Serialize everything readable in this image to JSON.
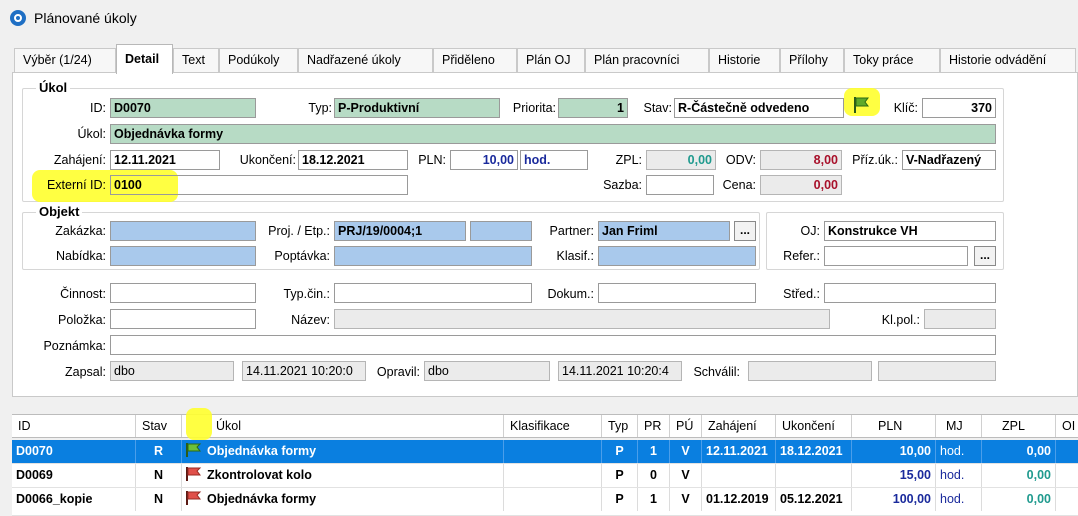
{
  "window": {
    "title": "Plánované úkoly"
  },
  "tabs": [
    {
      "label": "Výběr (1/24)"
    },
    {
      "label": "Detail"
    },
    {
      "label": "Text"
    },
    {
      "label": "Podúkoly"
    },
    {
      "label": "Nadřazené úkoly"
    },
    {
      "label": "Přiděleno"
    },
    {
      "label": "Plán OJ"
    },
    {
      "label": "Plán pracovníci"
    },
    {
      "label": "Historie"
    },
    {
      "label": "Přílohy"
    },
    {
      "label": "Toky práce"
    },
    {
      "label": "Historie odvádění"
    }
  ],
  "ukol": {
    "group_title": "Úkol",
    "id_label": "ID:",
    "id_value": "D0070",
    "typ_label": "Typ:",
    "typ_value": "P-Produktivní",
    "priorita_label": "Priorita:",
    "priorita_value": "1",
    "stav_label": "Stav:",
    "stav_value": "R-Částečně odvedeno",
    "klic_label": "Klíč:",
    "klic_value": "370",
    "ukol_label": "Úkol:",
    "ukol_value": "Objednávka formy",
    "zahajeni_label": "Zahájení:",
    "zahajeni_value": "12.11.2021",
    "ukonceni_label": "Ukončení:",
    "ukonceni_value": "18.12.2021",
    "pln_label": "PLN:",
    "pln_value": "10,00",
    "pln_unit": "hod.",
    "zpl_label": "ZPL:",
    "zpl_value": "0,00",
    "odv_label": "ODV:",
    "odv_value": "8,00",
    "priz_label": "Příz.úk.:",
    "priz_value": "V-Nadřazený",
    "externi_label": "Externí ID:",
    "externi_value": "0100",
    "sazba_label": "Sazba:",
    "sazba_value": "",
    "cena_label": "Cena:",
    "cena_value": "0,00"
  },
  "objekt": {
    "group_title": "Objekt",
    "zakazka_label": "Zakázka:",
    "zakazka_value": "",
    "proj_label": "Proj. / Etp.:",
    "proj_value": "PRJ/19/0004;1",
    "etp_value": "",
    "partner_label": "Partner:",
    "partner_value": "Jan Friml",
    "oj_label": "OJ:",
    "oj_value": "Konstrukce VH",
    "nabidka_label": "Nabídka:",
    "nabidka_value": "",
    "poptavka_label": "Poptávka:",
    "poptavka_value": "",
    "klasif_label": "Klasif.:",
    "klasif_value": "",
    "refer_label": "Refer.:",
    "refer_value": "",
    "ellipsis": "..."
  },
  "extra": {
    "cinnost_label": "Činnost:",
    "cinnost_value": "",
    "typcin_label": "Typ.čin.:",
    "typcin_value": "",
    "dokum_label": "Dokum.:",
    "dokum_value": "",
    "stred_label": "Střed.:",
    "stred_value": "",
    "polozka_label": "Položka:",
    "polozka_value": "",
    "nazev_label": "Název:",
    "nazev_value": "",
    "klpol_label": "Kl.pol.:",
    "klpol_value": "",
    "poznamka_label": "Poznámka:",
    "poznamka_value": "",
    "zapsal_label": "Zapsal:",
    "zapsal_value": "dbo",
    "zapsal_date": "14.11.2021 10:20:0",
    "opravil_label": "Opravil:",
    "opravil_value": "dbo",
    "opravil_date": "14.11.2021 10:20:4",
    "schvalil_label": "Schválil:",
    "schvalil_value": "",
    "schvalil_date": ""
  },
  "grid": {
    "headers": [
      "ID",
      "Stav",
      "Úkol",
      "Klasifikace",
      "Typ",
      "PR",
      "PÚ",
      "Zahájení",
      "Ukončení",
      "PLN",
      "MJ",
      "ZPL",
      "OI"
    ],
    "rows": [
      {
        "id": "D0070",
        "stav": "R",
        "flag": "green-flag-icon",
        "ukol": "Objednávka formy",
        "klasifikace": "",
        "typ": "P",
        "pr": "1",
        "pu": "V",
        "zahajeni": "12.11.2021",
        "ukonceni": "18.12.2021",
        "pln": "10,00",
        "mj": "hod.",
        "zpl": "0,00"
      },
      {
        "id": "D0069",
        "stav": "N",
        "flag": "red-flag-icon",
        "ukol": "Zkontrolovat kolo",
        "klasifikace": "",
        "typ": "P",
        "pr": "0",
        "pu": "V",
        "zahajeni": "",
        "ukonceni": "",
        "pln": "15,00",
        "mj": "hod.",
        "zpl": "0,00"
      },
      {
        "id": "D0066_kopie",
        "stav": "N",
        "flag": "red-flag-icon",
        "ukol": "Objednávka formy",
        "klasifikace": "",
        "typ": "P",
        "pr": "1",
        "pu": "V",
        "zahajeni": "01.12.2019",
        "ukonceni": "05.12.2021",
        "pln": "100,00",
        "mj": "hod.",
        "zpl": "0,00"
      }
    ]
  },
  "colors": {
    "selection": "#0a7fe0",
    "green_field": "#b7dbc5",
    "blue_field": "#a9c9ec",
    "navy_text": "#1a2a9c",
    "teal_text": "#1f9a8e",
    "maroon_text": "#a8102a",
    "highlight": "#ffff2e"
  }
}
